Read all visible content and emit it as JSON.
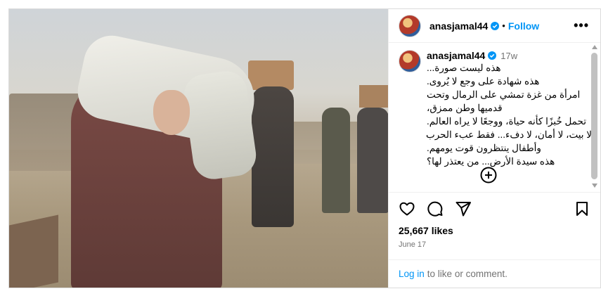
{
  "header": {
    "username": "anasjamal44",
    "dot": "•",
    "follow_label": "Follow",
    "more_label": "•••"
  },
  "caption": {
    "username": "anasjamal44",
    "time": "17w",
    "lines": [
      "هذه ليست صورة...",
      "هذه شهادة على وجع لا يُروى.",
      "امرأة من غزة تمشي على الرمال وتحت",
      "قدميها وطن ممزق،",
      "تحمل خُبزًا كأنه حياة، ووجعًا لا يراه العالم.",
      "لا بيت، لا أمان، لا دفء... فقط عبء الحرب",
      "وأطفال ينتظرون قوت يومهم.",
      "هذه سيدة الأرض... من يعتذر لها؟"
    ]
  },
  "icons": {
    "avatar": "avatar",
    "verified": "verified-badge-icon",
    "load_more": "plus-circle-icon",
    "like": "heart-icon",
    "comment": "comment-icon",
    "share": "send-icon",
    "save": "bookmark-icon"
  },
  "stats": {
    "likes": "25,667 likes",
    "date": "June 17"
  },
  "footer": {
    "login_label": "Log in",
    "rest": "to like or comment."
  },
  "colors": {
    "accent": "#0095f6",
    "muted": "#737373",
    "border": "#dbdbdb"
  }
}
